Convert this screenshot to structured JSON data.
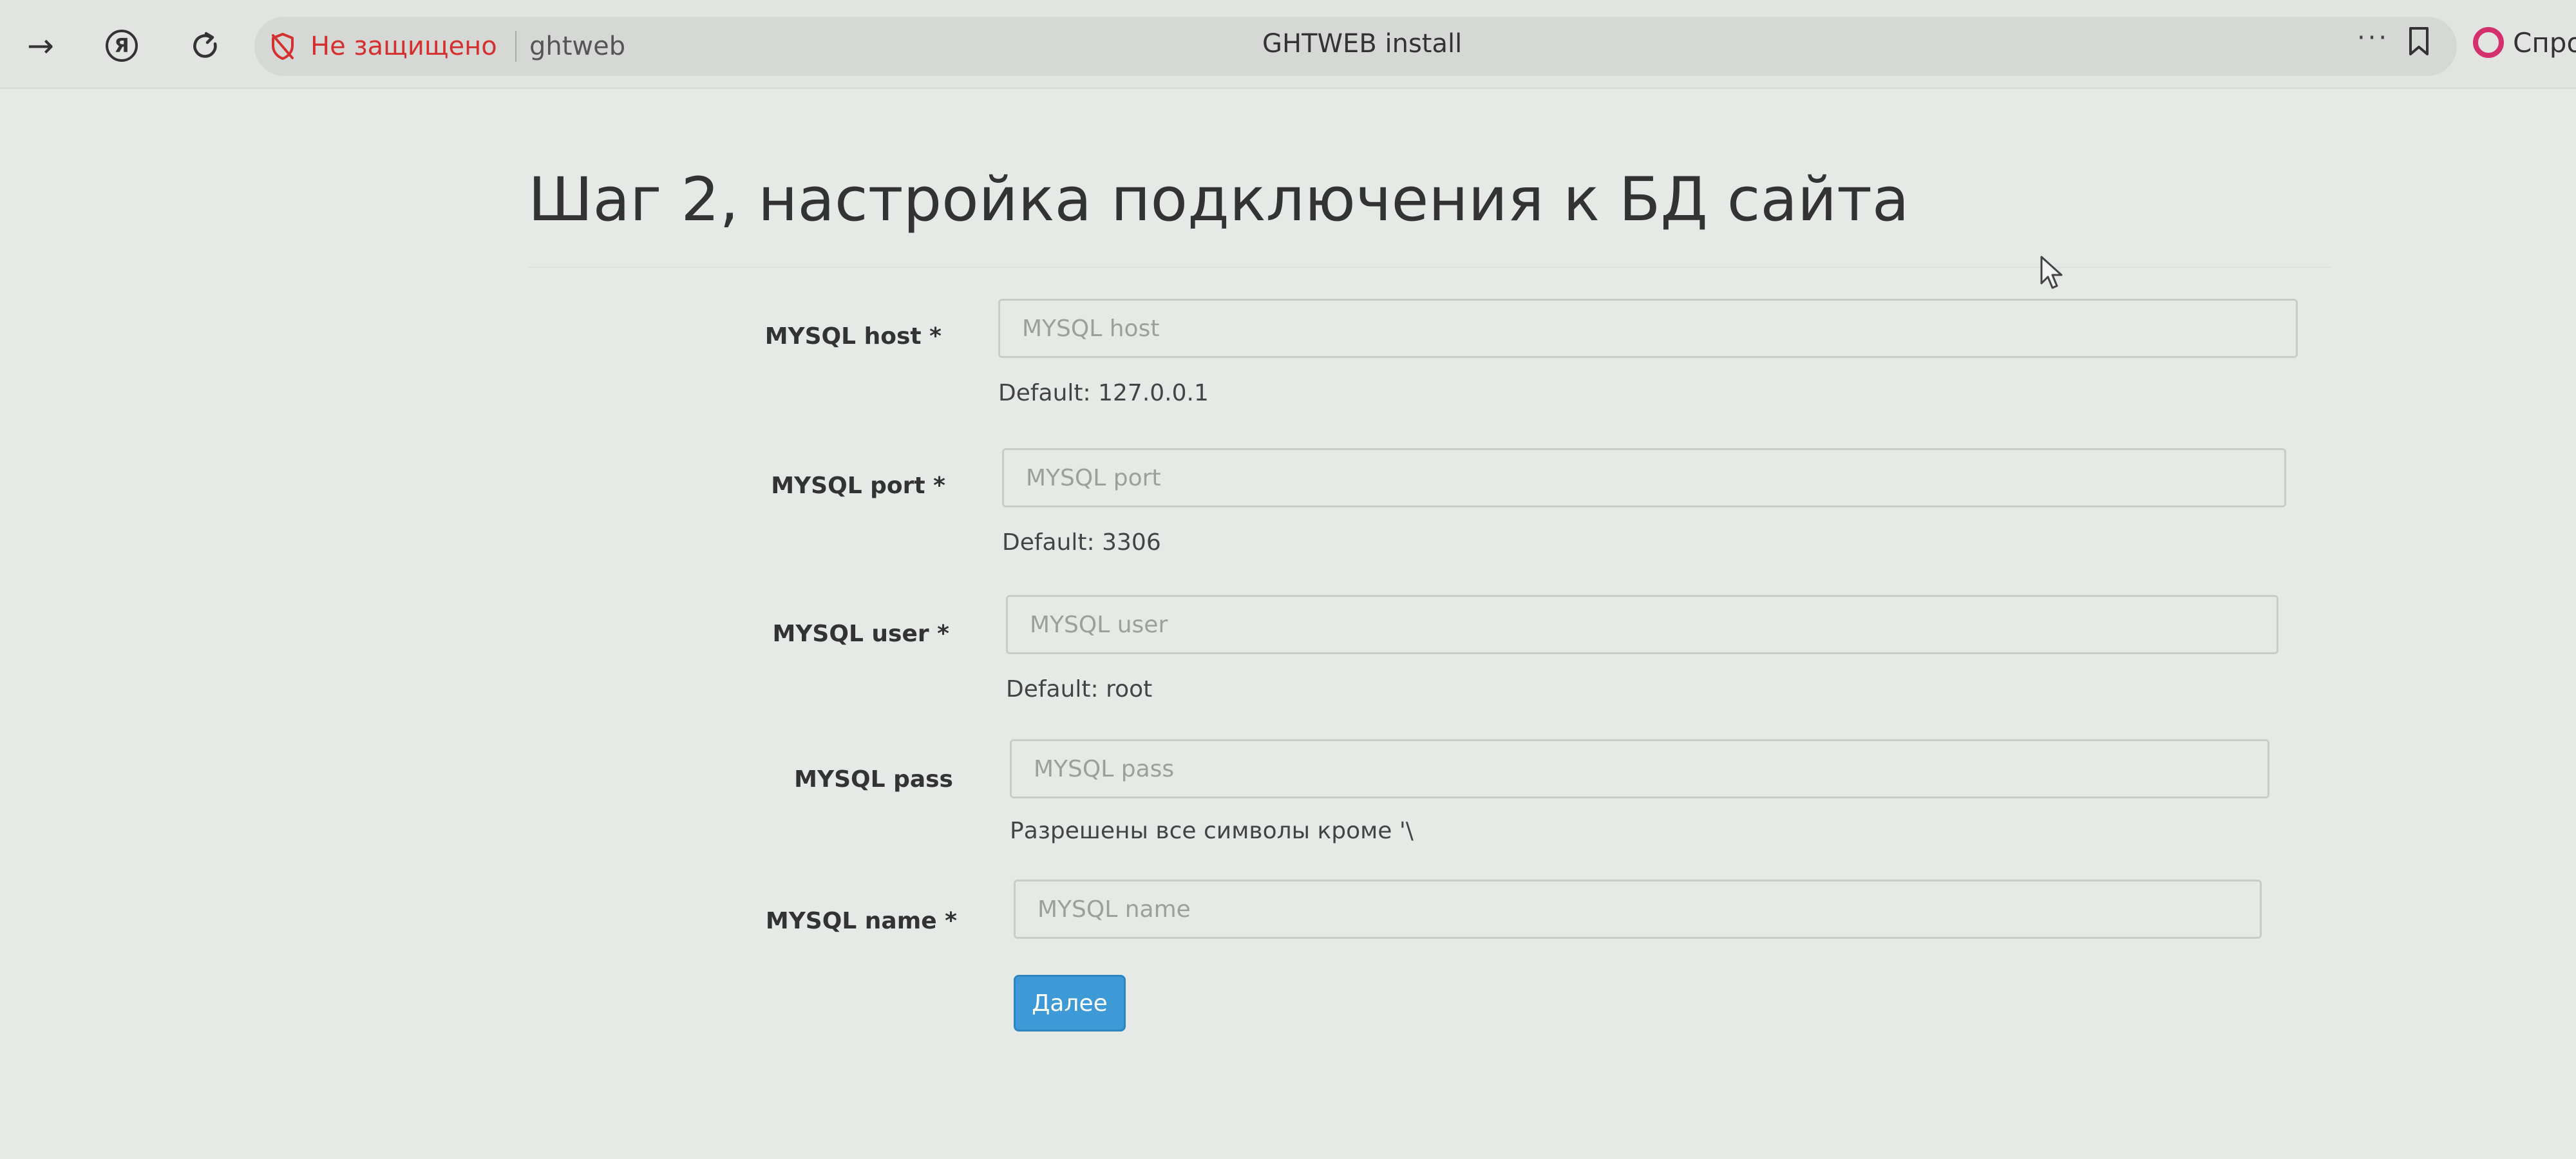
{
  "browser": {
    "security_label": "Не защищено",
    "url": "ghtweb",
    "tab_title": "GHTWEB install",
    "more_label": "···",
    "alice_label": "Спро",
    "ya_glyph": "Я"
  },
  "page": {
    "title": "Шаг 2, настройка подключения к БД сайта"
  },
  "form": {
    "fields": [
      {
        "label": "MYSQL host *",
        "placeholder": "MYSQL host",
        "help": "Default: 127.0.0.1"
      },
      {
        "label": "MYSQL port *",
        "placeholder": "MYSQL port",
        "help": "Default: 3306"
      },
      {
        "label": "MYSQL user *",
        "placeholder": "MYSQL user",
        "help": "Default: root"
      },
      {
        "label": "MYSQL pass",
        "placeholder": "MYSQL pass",
        "help": "Разрешены все символы кроме '\\"
      },
      {
        "label": "MYSQL name *",
        "placeholder": "MYSQL name",
        "help": ""
      }
    ],
    "submit_label": "Далее"
  },
  "colors": {
    "warning": "#d4302f",
    "primary_button": "#3e9ad6",
    "alice_accent": "#d4306e"
  }
}
